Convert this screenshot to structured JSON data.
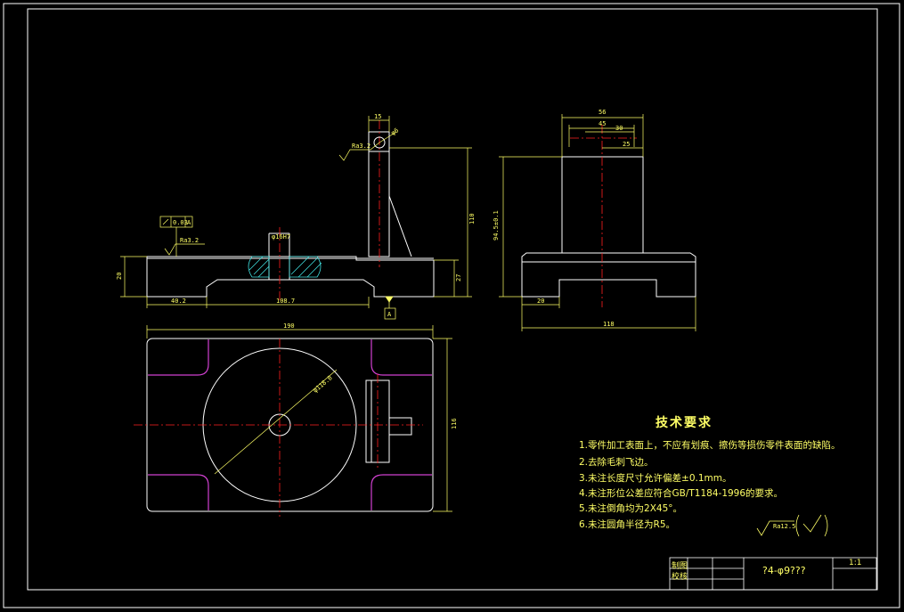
{
  "colors": {
    "background": "#000000",
    "outline": "#ffffff",
    "centerline": "#ff2020",
    "dimension": "#ffff66",
    "hatch": "#40e0e0",
    "corner": "#d040d0"
  },
  "front_view": {
    "dims": {
      "height_left": "20",
      "width_left": "40.2",
      "width_mid": "108.7",
      "post_width": "15",
      "post_height": "110",
      "step_height": "27",
      "bore": "φ16H7",
      "hole": "φ6"
    },
    "roughness_top": "Ra3.2",
    "roughness_post": "Ra3.2",
    "flatness_value": "0.03",
    "flatness_datum": "A",
    "datum_label": "A"
  },
  "side_view": {
    "dims": {
      "top_56": "56",
      "top_45": "45",
      "top_30": "30",
      "top_25": "25",
      "height": "94.5±0.1",
      "foot_width": "20",
      "total_width": "118"
    }
  },
  "top_view": {
    "dims": {
      "width": "190",
      "height": "116",
      "circle_dia": "φ118.8"
    }
  },
  "tech_requirements": {
    "title": "技术要求",
    "items": [
      "1.零件加工表面上，不应有划痕、擦伤等损伤零件表面的缺陷。",
      "2.去除毛刺飞边。",
      "3.未注长度尺寸允许偏差±0.1mm。",
      "4.未注形位公差应符合GB/T1184-1996的要求。",
      "5.未注倒角均为2X45°。",
      "6.未注圆角半径为R5。"
    ],
    "roughness_general": "Ra12.5"
  },
  "title_block": {
    "row1_label": "制图",
    "row2_label": "校核",
    "part_name": "?4-φ9???",
    "scale": "1:1"
  }
}
